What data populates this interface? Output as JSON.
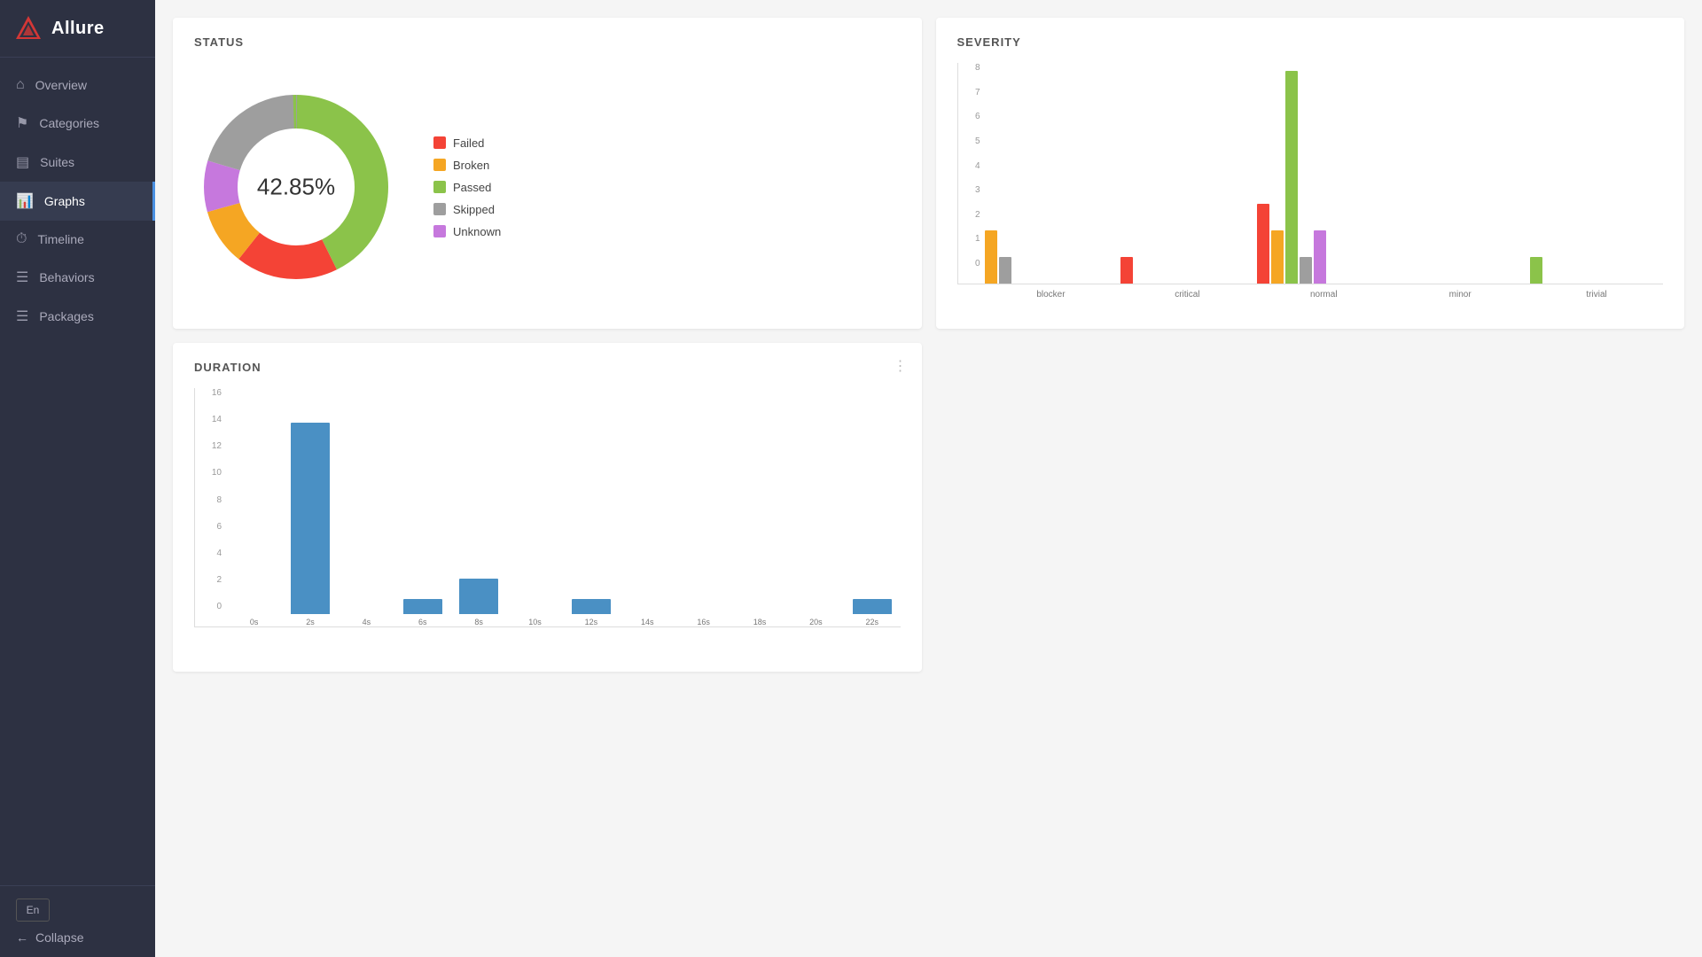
{
  "sidebar": {
    "logo": "Allure",
    "nav": [
      {
        "id": "overview",
        "label": "Overview",
        "icon": "⌂"
      },
      {
        "id": "categories",
        "label": "Categories",
        "icon": "⚑"
      },
      {
        "id": "suites",
        "label": "Suites",
        "icon": "▤"
      },
      {
        "id": "graphs",
        "label": "Graphs",
        "icon": "📊",
        "active": true
      },
      {
        "id": "timeline",
        "label": "Timeline",
        "icon": "⏱"
      },
      {
        "id": "behaviors",
        "label": "Behaviors",
        "icon": "☰"
      },
      {
        "id": "packages",
        "label": "Packages",
        "icon": "☰"
      }
    ],
    "lang_button": "En",
    "collapse_label": "Collapse"
  },
  "status": {
    "title": "STATUS",
    "percentage": "42.85%",
    "legend": [
      {
        "label": "Failed",
        "color": "#f44336"
      },
      {
        "label": "Broken",
        "color": "#f5a623"
      },
      {
        "label": "Passed",
        "color": "#8bc34a"
      },
      {
        "label": "Skipped",
        "color": "#9e9e9e"
      },
      {
        "label": "Unknown",
        "color": "#c678dd"
      }
    ],
    "donut": {
      "failed_pct": 18,
      "broken_pct": 10,
      "passed_pct": 43,
      "skipped_pct": 20,
      "unknown_pct": 9
    }
  },
  "severity": {
    "title": "SEVERITY",
    "y_labels": [
      "8",
      "7",
      "6",
      "5",
      "4",
      "3",
      "2",
      "1",
      "0"
    ],
    "groups": [
      {
        "label": "blocker",
        "bars": [
          {
            "color": "#f5a623",
            "value": 2
          },
          {
            "color": "#9e9e9e",
            "value": 1
          }
        ]
      },
      {
        "label": "critical",
        "bars": [
          {
            "color": "#f44336",
            "value": 1
          }
        ]
      },
      {
        "label": "normal",
        "bars": [
          {
            "color": "#f44336",
            "value": 3
          },
          {
            "color": "#f5a623",
            "value": 2
          },
          {
            "color": "#8bc34a",
            "value": 8
          },
          {
            "color": "#9e9e9e",
            "value": 1
          },
          {
            "color": "#c678dd",
            "value": 2
          }
        ]
      },
      {
        "label": "minor",
        "bars": []
      },
      {
        "label": "trivial",
        "bars": [
          {
            "color": "#8bc34a",
            "value": 1
          }
        ]
      }
    ],
    "max_value": 8
  },
  "duration": {
    "title": "DURATION",
    "menu_icon": "⋮",
    "y_labels": [
      "16",
      "14",
      "12",
      "10",
      "8",
      "6",
      "4",
      "2",
      "0"
    ],
    "bars": [
      {
        "label": "0s",
        "value": 0
      },
      {
        "label": "2s",
        "value": 15
      },
      {
        "label": "4s",
        "value": 0
      },
      {
        "label": "6s",
        "value": 1.2
      },
      {
        "label": "8s",
        "value": 2.8
      },
      {
        "label": "10s",
        "value": 0
      },
      {
        "label": "12s",
        "value": 1.2
      },
      {
        "label": "14s",
        "value": 0
      },
      {
        "label": "16s",
        "value": 0
      },
      {
        "label": "18s",
        "value": 0
      },
      {
        "label": "20s",
        "value": 0
      },
      {
        "label": "22s",
        "value": 1.2
      }
    ],
    "max_value": 16
  }
}
